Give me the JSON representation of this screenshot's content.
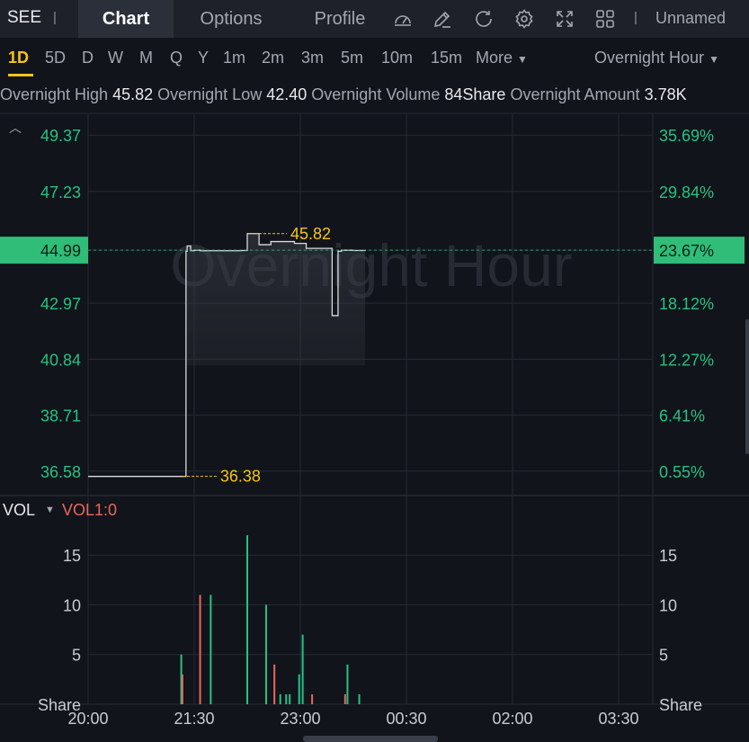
{
  "header": {
    "ticker": "SEE",
    "tabs": [
      {
        "label": "Chart",
        "active": true
      },
      {
        "label": "Options",
        "active": false
      },
      {
        "label": "Profile",
        "active": false
      }
    ],
    "icons": [
      "gauge-icon",
      "draw-icon",
      "refresh-icon",
      "settings-icon",
      "fullscreen-icon",
      "layout-grid-icon"
    ],
    "layout_name": "Unnamed"
  },
  "periods": {
    "items": [
      "1D",
      "5D",
      "D",
      "W",
      "M",
      "Q",
      "Y",
      "1m",
      "2m",
      "3m",
      "5m",
      "10m",
      "15m"
    ],
    "active": "1D",
    "more_label": "More",
    "session_label": "Overnight Hour"
  },
  "stats": [
    {
      "label": "Overnight High",
      "value": "45.82"
    },
    {
      "label": "Overnight Low",
      "value": "42.40"
    },
    {
      "label": "Overnight Volume",
      "value": "84Share"
    },
    {
      "label": "Overnight Amount",
      "value": "3.78K"
    }
  ],
  "colors": {
    "up": "#26c281",
    "down": "#e8675a",
    "highlight": "#f5c518",
    "current_price_bg": "#2fbd78"
  },
  "chart_data": [
    {
      "type": "line",
      "watermark": "Overnight Hour",
      "y_labels_left": [
        "49.37",
        "47.23",
        "44.99",
        "42.97",
        "40.84",
        "38.71",
        "36.58"
      ],
      "y_labels_right": [
        "35.69%",
        "29.84%",
        "23.67%",
        "18.12%",
        "12.27%",
        "6.41%",
        "0.55%"
      ],
      "current_price": "44.99",
      "current_change": "23.67%",
      "high_label": "45.82",
      "low_label": "36.38",
      "x": [
        "20:00",
        "21:20",
        "21:23",
        "21:24",
        "21:27",
        "21:30",
        "21:35",
        "21:40",
        "22:00",
        "22:10",
        "22:15",
        "22:20",
        "22:25",
        "22:30",
        "22:35",
        "22:40",
        "22:45",
        "22:50",
        "22:55",
        "23:00",
        "23:05",
        "23:10",
        "23:15",
        "23:20",
        "23:25",
        "23:27",
        "23:30",
        "23:32",
        "23:35",
        "23:40",
        "23:45",
        "23:50",
        "23:55"
      ],
      "y": [
        36.38,
        36.38,
        44.95,
        45.15,
        44.97,
        44.99,
        44.97,
        44.97,
        44.97,
        44.98,
        45.62,
        45.62,
        45.2,
        45.2,
        45.32,
        45.32,
        45.32,
        45.32,
        45.25,
        45.25,
        45.06,
        45.06,
        45.06,
        45.06,
        45.06,
        42.5,
        42.5,
        44.95,
        44.99,
        44.99,
        44.98,
        44.98,
        45.0
      ],
      "ylim": [
        35.65,
        50.2
      ],
      "x_ticks": [
        "20:00",
        "21:30",
        "23:00",
        "00:30",
        "02:00",
        "03:30"
      ]
    },
    {
      "type": "bar",
      "label": "VOL",
      "indicator": "VOL1:0",
      "y_ticks": [
        "15",
        "10",
        "5"
      ],
      "unit_label": "Share",
      "bars": [
        {
          "time": "21:19",
          "value": 5,
          "dir": "up"
        },
        {
          "time": "21:20",
          "value": 3,
          "dir": "down"
        },
        {
          "time": "21:35",
          "value": 11,
          "dir": "down"
        },
        {
          "time": "21:44",
          "value": 11,
          "dir": "up"
        },
        {
          "time": "22:15",
          "value": 17,
          "dir": "up"
        },
        {
          "time": "22:31",
          "value": 10,
          "dir": "up"
        },
        {
          "time": "22:38",
          "value": 4,
          "dir": "down"
        },
        {
          "time": "22:43",
          "value": 1,
          "dir": "up"
        },
        {
          "time": "22:48",
          "value": 1,
          "dir": "up"
        },
        {
          "time": "22:51",
          "value": 1,
          "dir": "up"
        },
        {
          "time": "22:59",
          "value": 3,
          "dir": "up"
        },
        {
          "time": "23:02",
          "value": 7,
          "dir": "up"
        },
        {
          "time": "23:10",
          "value": 1,
          "dir": "down"
        },
        {
          "time": "23:38",
          "value": 1,
          "dir": "down"
        },
        {
          "time": "23:40",
          "value": 4,
          "dir": "up"
        },
        {
          "time": "23:50",
          "value": 1,
          "dir": "up"
        }
      ],
      "ylim": [
        0,
        19
      ]
    }
  ]
}
